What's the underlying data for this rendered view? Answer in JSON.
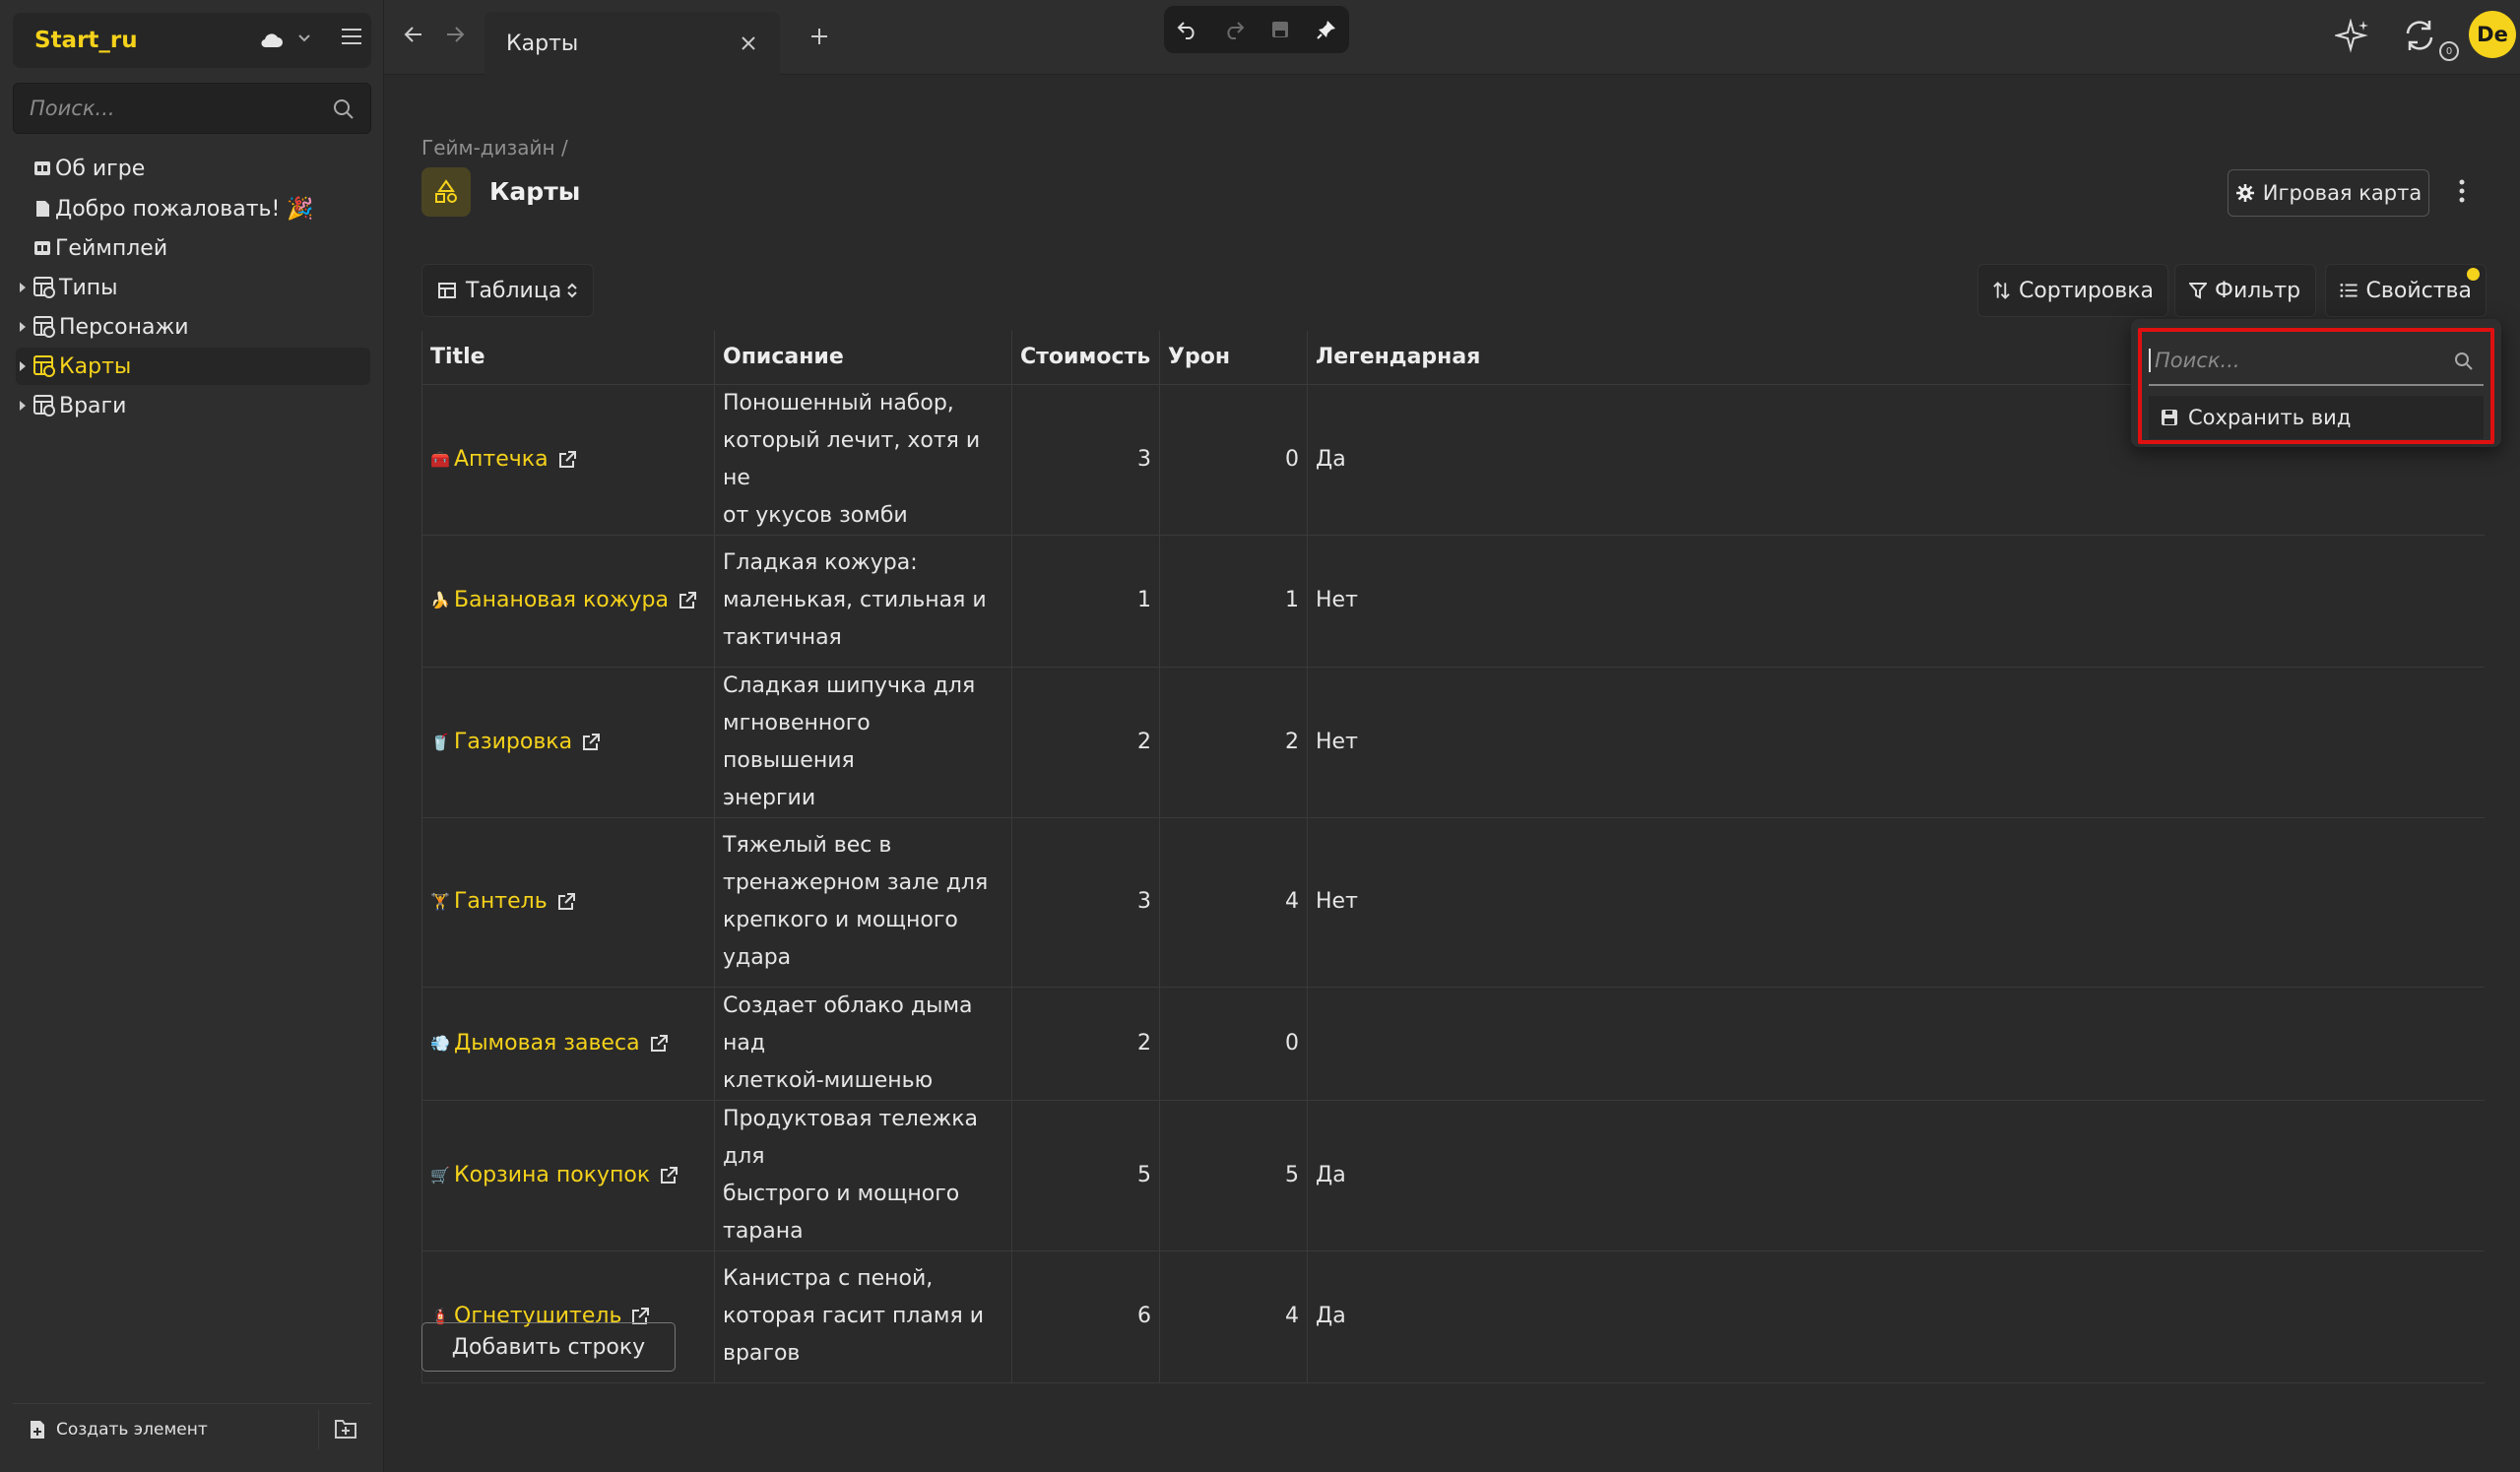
{
  "workspace": {
    "name": "Start_ru"
  },
  "sidebar": {
    "search_placeholder": "Поиск...",
    "items": [
      {
        "label": "Об игре",
        "icon": "page-icon",
        "expandable": false
      },
      {
        "label": "Добро пожаловать! 🎉",
        "icon": "document-icon",
        "expandable": false
      },
      {
        "label": "Геймплей",
        "icon": "page-icon",
        "expandable": false
      },
      {
        "label": "Типы",
        "icon": "database-icon",
        "expandable": true
      },
      {
        "label": "Персонажи",
        "icon": "database-icon",
        "expandable": true
      },
      {
        "label": "Карты",
        "icon": "database-icon",
        "expandable": true,
        "active": true
      },
      {
        "label": "Враги",
        "icon": "database-icon",
        "expandable": true
      }
    ],
    "create_label": "Создать элемент"
  },
  "tabs": [
    {
      "label": "Карты"
    }
  ],
  "user": {
    "initials": "De"
  },
  "sync": {
    "badge": "0"
  },
  "page": {
    "breadcrumb": "Гейм-дизайн /",
    "title": "Карты",
    "game_map_button": "Игровая карта"
  },
  "view": {
    "label": "Таблица",
    "sort_label": "Сортировка",
    "filter_label": "Фильтр",
    "properties_label": "Свойства"
  },
  "table": {
    "columns": [
      "Title",
      "Описание",
      "Стоимость",
      "Урон",
      "Легендарная"
    ],
    "rows": [
      {
        "emoji": "🧰",
        "title": "Аптечка",
        "desc": [
          "Поношенный набор,",
          "который лечит, хотя и не",
          "от укусов зомби"
        ],
        "cost": "3",
        "damage": "0",
        "legendary": "Да"
      },
      {
        "emoji": "🍌",
        "title": "Банановая кожура",
        "desc": [
          "Гладкая кожура:",
          "маленькая, стильная и",
          "тактичная"
        ],
        "cost": "1",
        "damage": "1",
        "legendary": "Нет"
      },
      {
        "emoji": "🥤",
        "title": "Газировка",
        "desc": [
          "Сладкая шипучка для",
          "мгновенного повышения",
          "энергии"
        ],
        "cost": "2",
        "damage": "2",
        "legendary": "Нет"
      },
      {
        "emoji": "🏋",
        "title": "Гантель",
        "desc": [
          "Тяжелый вес в",
          "тренажерном зале для",
          "крепкого и мощного",
          "удара"
        ],
        "cost": "3",
        "damage": "4",
        "legendary": "Нет"
      },
      {
        "emoji": "💨",
        "title": "Дымовая завеса",
        "desc": [
          "Создает облако дыма над",
          "клеткой-мишенью"
        ],
        "cost": "2",
        "damage": "0",
        "legendary": ""
      },
      {
        "emoji": "🛒",
        "title": "Корзина покупок",
        "desc": [
          "Продуктовая тележка для",
          "быстрого и мощного",
          "тарана"
        ],
        "cost": "5",
        "damage": "5",
        "legendary": "Да"
      },
      {
        "emoji": "🧯",
        "title": "Огнетушитель",
        "desc": [
          "Канистра с пеной,",
          "которая гасит пламя и",
          "врагов"
        ],
        "cost": "6",
        "damage": "4",
        "legendary": "Да"
      }
    ],
    "add_row_label": "Добавить строку"
  },
  "properties_dropdown": {
    "search_placeholder": "Поиск...",
    "save_view_label": "Сохранить вид",
    "highlight_color": "#e01010"
  },
  "colors": {
    "accent": "#f5d21b",
    "background": "#2a2a2a",
    "sidebar": "#2e2e2e"
  }
}
